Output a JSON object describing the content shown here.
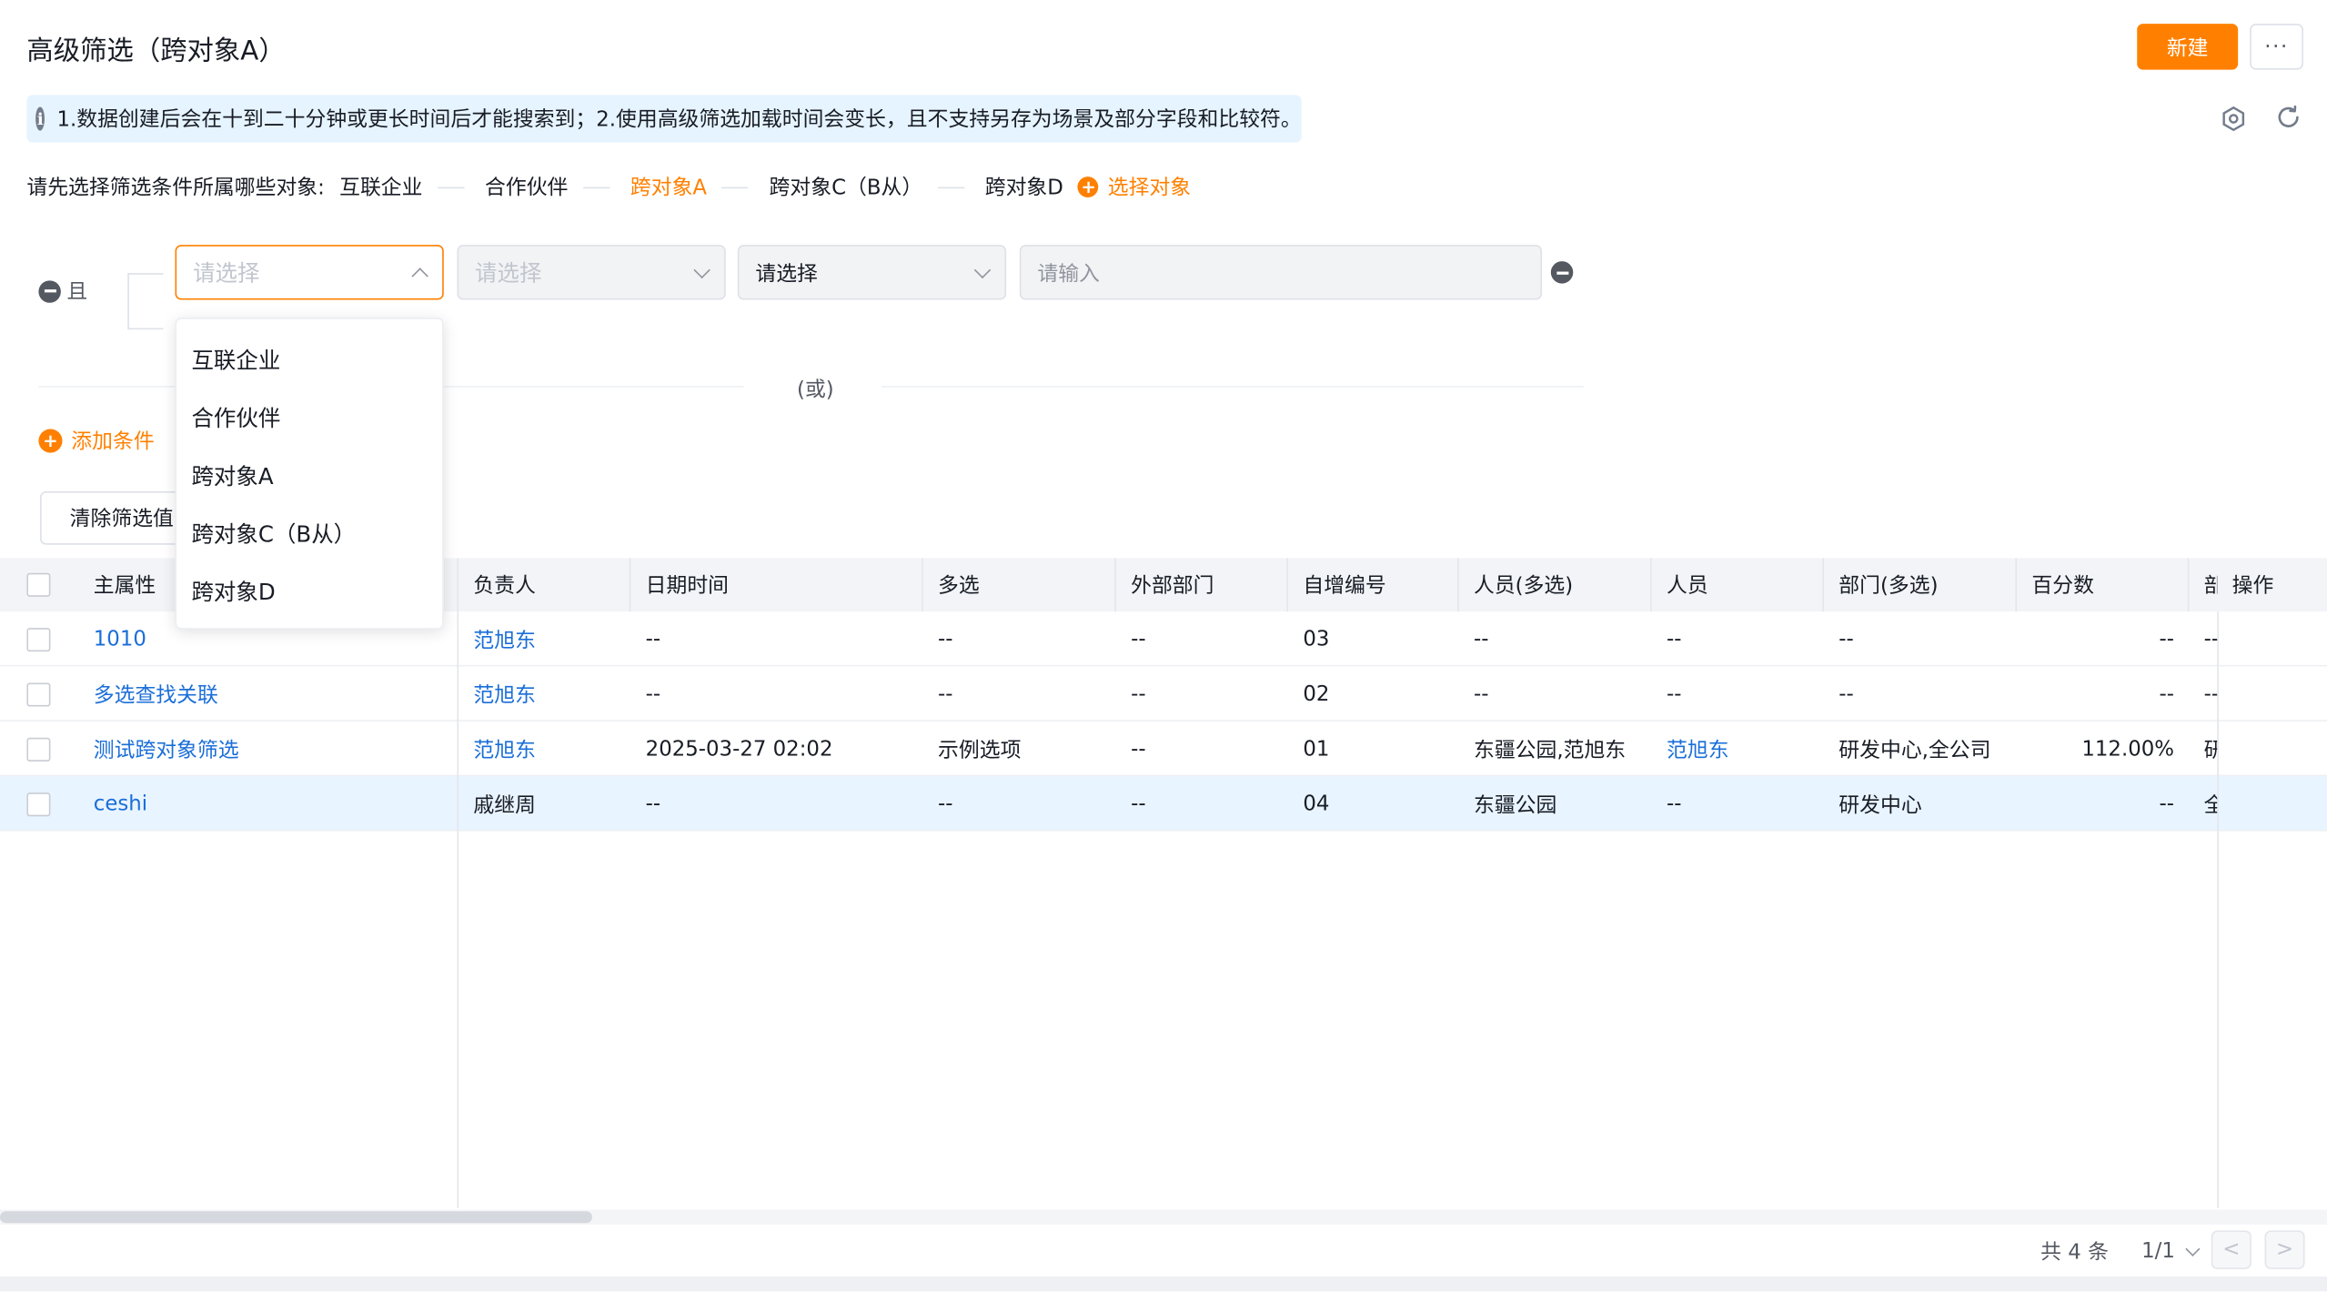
{
  "header": {
    "title": "高级筛选（跨对象A）",
    "new_label": "新建",
    "more_label": "···"
  },
  "notice": {
    "icon": "info-icon",
    "text": "1.数据创建后会在十到二十分钟或更长时间后才能搜索到；2.使用高级筛选加载时间会变长，且不支持另存为场景及部分字段和比较符。"
  },
  "objects": {
    "label": "请先选择筛选条件所属哪些对象:",
    "items": [
      "互联企业",
      "合作伙伴",
      "跨对象A",
      "跨对象C（B从）",
      "跨对象D"
    ],
    "active_index": 2,
    "select_label": "选择对象"
  },
  "condition": {
    "group_label": "且",
    "field1_placeholder": "请选择",
    "field2_placeholder": "请选择",
    "field3_value": "请选择",
    "value_placeholder": "请输入",
    "or_label": "(或)",
    "add_label": "添加条件",
    "clear_label": "清除筛选值"
  },
  "dropdown": {
    "options": [
      "互联企业",
      "合作伙伴",
      "跨对象A",
      "跨对象C（B从）",
      "跨对象D"
    ]
  },
  "table": {
    "columns": [
      "主属性",
      "负责人",
      "日期时间",
      "多选",
      "外部部门",
      "自增编号",
      "人员(多选)",
      "人员",
      "部门(多选)",
      "百分数",
      "部",
      "操作"
    ],
    "rows": [
      {
        "main": "1010",
        "owner": "范旭东",
        "datetime": "--",
        "multi": "--",
        "extdept": "--",
        "autonum": "03",
        "persons": "--",
        "person": "--",
        "depts": "--",
        "percent": "--",
        "dept": "--"
      },
      {
        "main": "多选查找关联",
        "owner": "范旭东",
        "datetime": "--",
        "multi": "--",
        "extdept": "--",
        "autonum": "02",
        "persons": "--",
        "person": "--",
        "depts": "--",
        "percent": "--",
        "dept": "--"
      },
      {
        "main": "测试跨对象筛选",
        "owner": "范旭东",
        "datetime": "2025-03-27 02:02",
        "multi": "示例选项",
        "extdept": "--",
        "autonum": "01",
        "persons": "东疆公园,范旭东",
        "person": "范旭东",
        "depts": "研发中心,全公司",
        "percent": "112.00%",
        "dept": "研"
      },
      {
        "main": "ceshi",
        "owner": "戚继周",
        "datetime": "--",
        "multi": "--",
        "extdept": "--",
        "autonum": "04",
        "persons": "东疆公园",
        "person": "--",
        "depts": "研发中心",
        "percent": "--",
        "dept": "全"
      }
    ]
  },
  "pager": {
    "total": "共 4 条",
    "page": "1/1",
    "prev": "<",
    "next": ">"
  },
  "colors": {
    "accent": "#ff8000",
    "link": "#1a6ed8",
    "notice_bg": "#e6f4ff",
    "highlight_row": "#e8f4ff"
  }
}
